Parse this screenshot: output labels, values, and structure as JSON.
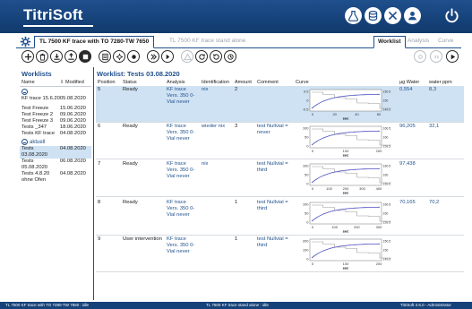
{
  "app": {
    "logo": "TitriSoft"
  },
  "header": {
    "icons": [
      "flask-icon",
      "database-icon",
      "tools-icon",
      "user-icon"
    ],
    "power": "power-icon"
  },
  "tabs": {
    "active": "TL 7500 KF trace with TO 7280-TW 7650",
    "inactive": "TL 7500 KF trace stand alone",
    "right": [
      {
        "label": "Worklist",
        "active": true
      },
      {
        "label": "Analysis",
        "active": false
      },
      {
        "label": "Curve",
        "active": false
      }
    ]
  },
  "left_panel": {
    "title": "Worklists",
    "col_name": "Name",
    "col_modified": "Modified",
    "groups": [
      {
        "label": "",
        "items": [
          {
            "name": "KF trace 15.6.20",
            "date": "05.08.2020"
          },
          {
            "name": "Test Freeze",
            "date": "15.06.2020"
          },
          {
            "name": "Test Freeze 2",
            "date": "09.06.2020"
          },
          {
            "name": "Test Freeze 3",
            "date": "09.06.2020"
          },
          {
            "name": "Tests _347",
            "date": "18.06.2020"
          },
          {
            "name": "Tests KF trace",
            "date": "04.08.2020"
          }
        ]
      },
      {
        "label": "aktuell",
        "items": [
          {
            "name": "Tests 03.08.2020",
            "date": "04.08.2020",
            "selected": true
          },
          {
            "name": "Tests 05.08.2020",
            "date": "06.08.2020"
          },
          {
            "name": "Tests 4.8.20 ohne Ofen",
            "date": "04.08.2020"
          }
        ]
      }
    ]
  },
  "main": {
    "title": "Worklist: Tests 03.08.2020",
    "headers": {
      "position": "Position",
      "status": "Status",
      "analysis": "Analysis",
      "identification": "Identification",
      "amount": "Amount",
      "comment": "Comment",
      "curve": "Curve",
      "ug_water": "µg Water",
      "water_ppm": "water ppm"
    },
    "rows": [
      {
        "position": "5",
        "status": "Ready",
        "analysis": "KF trace Vers. 350 0-Vial never",
        "identification": "nix",
        "amount": "2",
        "comment": "",
        "ug_water": "0,554",
        "ppm": "8,3",
        "selected": true,
        "curve": {
          "y_ticks": [
            "0.5",
            "0",
            "-0.5"
          ],
          "x_ticks": [
            "0",
            "20",
            "40",
            "60"
          ],
          "r_ticks": [
            "150.5",
            "150",
            "149.5"
          ],
          "xlabel": "sec"
        }
      },
      {
        "position": "6",
        "status": "Ready",
        "analysis": "KF trace Vers. 350 0-Vial never",
        "identification": "wieder nix",
        "amount": "3",
        "comment": "test Nullvial = never",
        "ug_water": "96,205",
        "ppm": "32,1",
        "curve": {
          "y_ticks": [
            "100",
            "50",
            "0"
          ],
          "x_ticks": [
            "0",
            "100",
            "200"
          ],
          "r_ticks": [
            "160.5",
            "160",
            "159.5"
          ],
          "xlabel": "sec"
        }
      },
      {
        "position": "7",
        "status": "Ready",
        "analysis": "KF trace Vers. 350 0-Vial never",
        "identification": "nix",
        "amount": "",
        "comment": "test Nullvial = third",
        "ug_water": "97,438",
        "ppm": "",
        "curve": {
          "y_ticks": [
            "100",
            "50",
            "0"
          ],
          "x_ticks": [
            "0",
            "100",
            "200",
            "300",
            "400"
          ],
          "r_ticks": [
            "160.5",
            "160",
            "159.5"
          ],
          "xlabel": "sec"
        }
      },
      {
        "position": "8",
        "status": "Ready",
        "analysis": "KF trace Vers. 350 0-Vial never",
        "identification": "",
        "amount": "1",
        "comment": "test Nullvial = third",
        "ug_water": "70,165",
        "ppm": "70,2",
        "curve": {
          "y_ticks": [
            "100",
            "50",
            "0"
          ],
          "x_ticks": [
            "0",
            "100",
            "200",
            "300"
          ],
          "r_ticks": [
            "160.5",
            "160",
            "159.5"
          ],
          "xlabel": "sec"
        }
      },
      {
        "position": "9",
        "status": "User intervention",
        "analysis": "KF trace Vers. 350 0-Vial never",
        "identification": "",
        "amount": "1",
        "comment": "test Nullvial = third",
        "ug_water": "",
        "ppm": "",
        "curve": {
          "y_ticks": [
            "200",
            "100",
            "0"
          ],
          "x_ticks": [
            "0",
            "100",
            "200"
          ],
          "r_ticks": [
            "150.5",
            "150",
            "149.5"
          ],
          "xlabel": "sec"
        }
      }
    ]
  },
  "statusbar": {
    "left": "TL 7500 KF trace with TO 7280-TW 7650 : idle",
    "center": "TL 7500 KF trace stand alone : idle",
    "right": "TitriSoft 3.5.0 - Administrator"
  },
  "colors": {
    "header": "#1f4f8c",
    "selected_row": "#cfe2f3",
    "curve_blue": "#4a4fbf",
    "curve_gray": "#9a9a9a"
  }
}
